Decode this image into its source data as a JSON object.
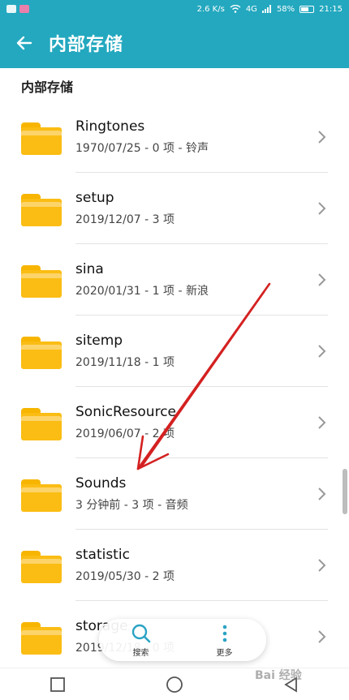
{
  "status_bar": {
    "network_speed": "2.6 K/s",
    "signal_label": "4G",
    "battery": "58%",
    "time": "21:15"
  },
  "app_bar": {
    "title": "内部存储"
  },
  "section": {
    "title": "内部存储"
  },
  "files": [
    {
      "name": "Ringtones",
      "meta": "1970/07/25 - 0 项 - 铃声"
    },
    {
      "name": "setup",
      "meta": "2019/12/07 - 3 项"
    },
    {
      "name": "sina",
      "meta": "2020/01/31 - 1 项 - 新浪"
    },
    {
      "name": "sitemp",
      "meta": "2019/11/18 - 1 项"
    },
    {
      "name": "SonicResource",
      "meta": "2019/06/07 - 2 项"
    },
    {
      "name": "Sounds",
      "meta": "3 分钟前 - 3 项 - 音频"
    },
    {
      "name": "statistic",
      "meta": "2019/05/30 - 2 项"
    },
    {
      "name": "storage",
      "meta": "2019/12/18 - 0 项"
    }
  ],
  "bottom_actions": {
    "search_label": "搜索",
    "more_label": "更多"
  },
  "watermark": "Bai 经验",
  "colors": {
    "primary": "#23a8bf",
    "folder": "#fbbd14",
    "annotation_arrow": "#d42121"
  },
  "icons": {
    "back": "arrow-left-icon",
    "folder": "folder-icon",
    "chevron": "chevron-right-icon",
    "search": "search-icon",
    "more": "more-vertical-icon"
  }
}
